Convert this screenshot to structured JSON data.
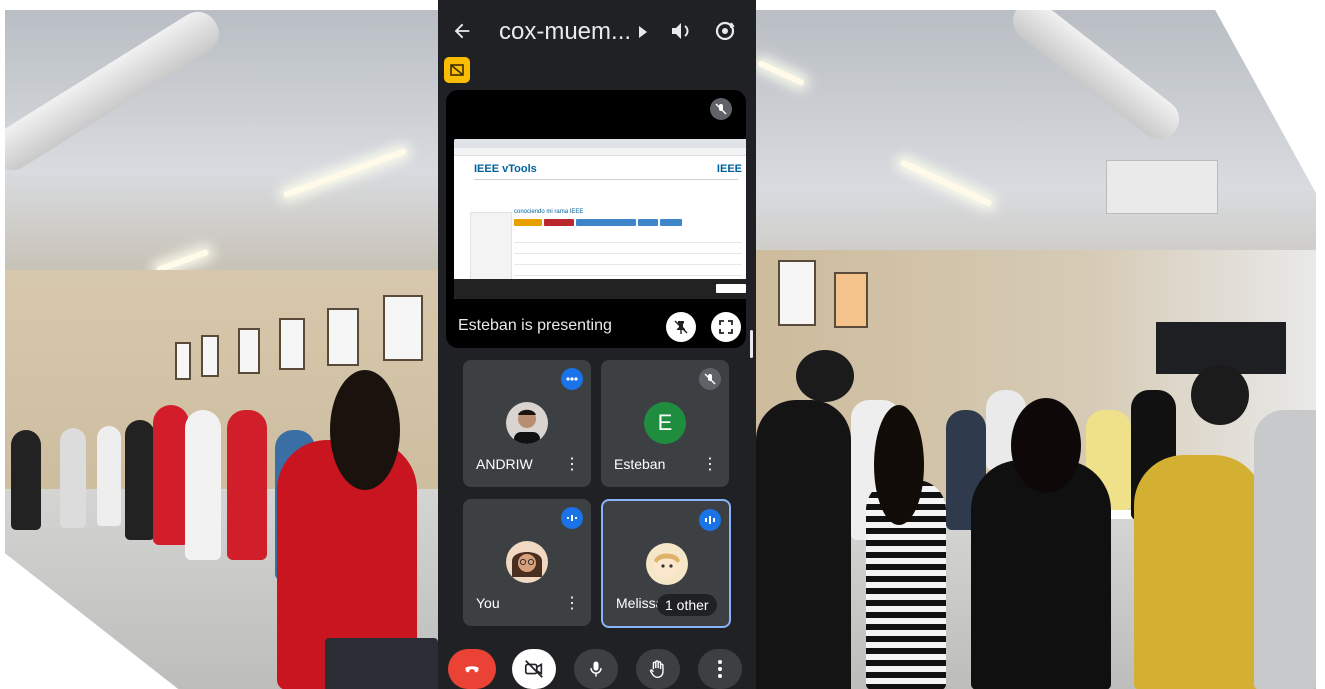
{
  "meeting": {
    "title": "cox-muem...",
    "presenting_label": "Esteban is presenting"
  },
  "shared_screen": {
    "site_brand": "IEEE vTools",
    "site_logo": "IEEE",
    "event_title": "conociendo mi rama IEEE",
    "badge_colors": [
      "#e7a000",
      "#b9282d",
      "#3e86c9",
      "#3e86c9",
      "#3e86c9"
    ]
  },
  "participants": [
    {
      "name": "ANDRIW",
      "status": "speaking-indicator"
    },
    {
      "name": "Esteban",
      "initial": "E",
      "status": "muted"
    },
    {
      "name": "You",
      "status": "speaking-indicator"
    },
    {
      "name": "Melissa",
      "status": "speaking-indicator",
      "extra": "1 other"
    }
  ],
  "controls": [
    "end-call",
    "camera-off",
    "microphone",
    "raise-hand",
    "more-options"
  ],
  "colors": {
    "background": "#202124",
    "tile": "#3c4043",
    "accent": "#1a73e8",
    "end_call": "#ea4335",
    "flag": "#fbbc04",
    "avatar_e": "#1e8e3e"
  }
}
